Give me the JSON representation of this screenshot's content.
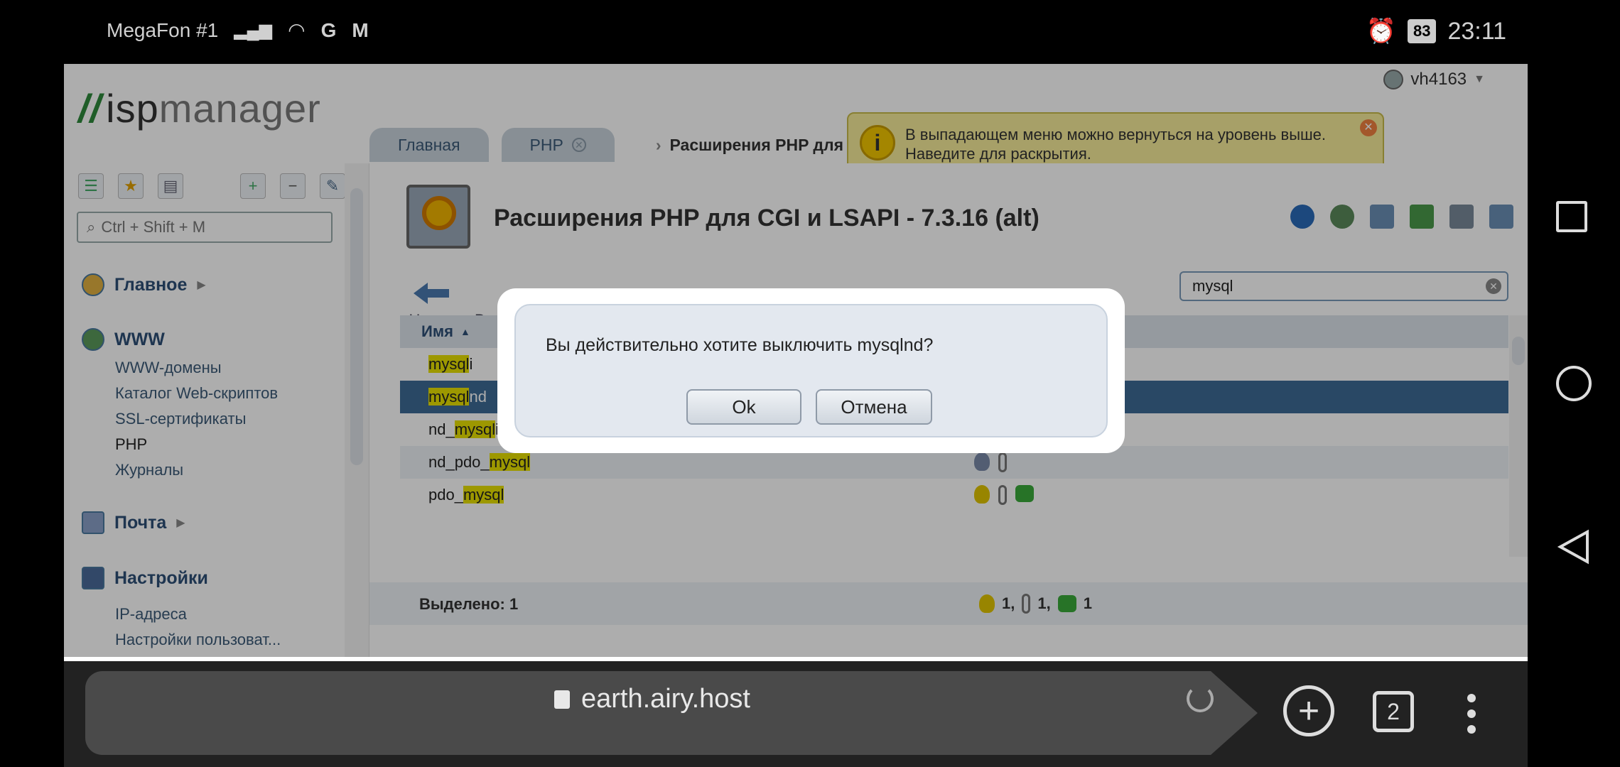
{
  "status_bar": {
    "carrier": "MegaFon #1",
    "net_letter": "M",
    "battery": "83",
    "time": "23:11"
  },
  "app": {
    "logo_prefix": "isp",
    "logo_suffix": "manager",
    "user": "vh4163"
  },
  "tabs": [
    {
      "label": "Главная"
    },
    {
      "label": "PHP"
    },
    {
      "label": "Расширения PHP для CGI и ..."
    }
  ],
  "tooltip": {
    "text": "В выпадающем меню можно вернуться на уровень выше. Наведите для раскрытия.",
    "info_glyph": "i"
  },
  "sidebar": {
    "search_placeholder": "Ctrl + Shift + M",
    "sections": {
      "main": "Главное",
      "www": "WWW",
      "mail": "Почта",
      "settings": "Настройки"
    },
    "www_items": [
      "WWW-домены",
      "Каталог Web-скриптов",
      "SSL-сертификаты",
      "PHP",
      "Журналы"
    ],
    "settings_items": [
      "IP-адреса",
      "Настройки пользоват..."
    ]
  },
  "main": {
    "title": "Расширения PHP для CGI и LSAPI - 7.3.16 (alt)",
    "back_label": "Назад",
    "vk_label": "Вк",
    "filter_value": "mysql",
    "column_name": "Имя",
    "rows": [
      {
        "hl": "mysql",
        "rest": "i"
      },
      {
        "hl": "mysql",
        "rest": "nd"
      },
      {
        "pre": "nd_",
        "hl": "mysql",
        "rest": "i"
      },
      {
        "pre": "nd_pdo_",
        "hl": "mysql",
        "rest": ""
      },
      {
        "pre": "pdo_",
        "hl": "mysql",
        "rest": ""
      }
    ],
    "footer_selected": "Выделено: 1",
    "footer_counts": [
      "1,",
      "1,",
      "1"
    ]
  },
  "modal": {
    "message": "Вы действительно хотите выключить mysqlnd?",
    "ok_label": "Ok",
    "cancel_label": "Отмена"
  },
  "browser": {
    "url": "earth.airy.host",
    "tab_count": "2"
  }
}
